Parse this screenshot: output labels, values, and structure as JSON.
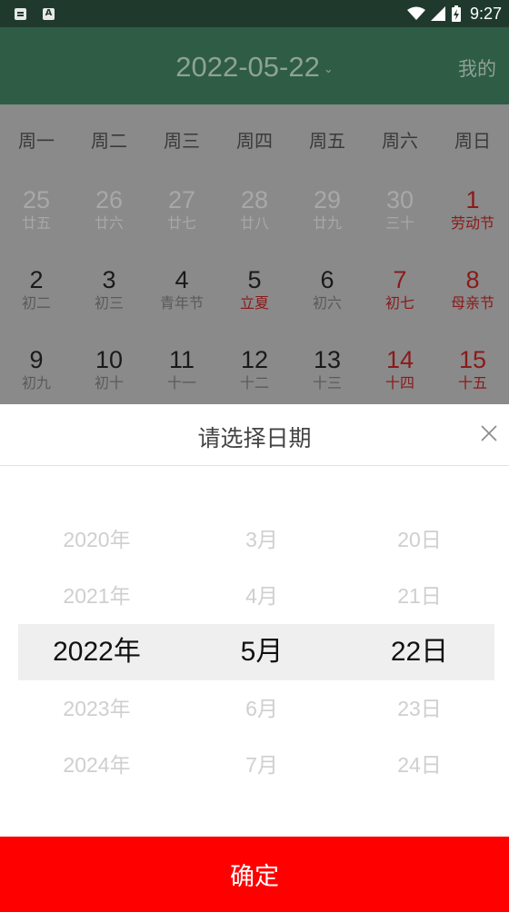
{
  "status_bar": {
    "time": "9:27",
    "icons": [
      "message-icon",
      "a-app-icon",
      "wifi-icon",
      "signal-icon",
      "battery-icon"
    ]
  },
  "header": {
    "date": "2022-05-22",
    "caret": "⌄",
    "mine": "我的"
  },
  "calendar": {
    "weekdays": [
      "周一",
      "周二",
      "周三",
      "周四",
      "周五",
      "周六",
      "周日"
    ],
    "days": [
      {
        "num": "25",
        "lunar": "廿五",
        "state": "muted"
      },
      {
        "num": "26",
        "lunar": "廿六",
        "state": "muted"
      },
      {
        "num": "27",
        "lunar": "廿七",
        "state": "muted"
      },
      {
        "num": "28",
        "lunar": "廿八",
        "state": "muted"
      },
      {
        "num": "29",
        "lunar": "廿九",
        "state": "muted"
      },
      {
        "num": "30",
        "lunar": "三十",
        "state": "muted"
      },
      {
        "num": "1",
        "lunar": "劳动节",
        "state": "weekend festival"
      },
      {
        "num": "2",
        "lunar": "初二",
        "state": ""
      },
      {
        "num": "3",
        "lunar": "初三",
        "state": ""
      },
      {
        "num": "4",
        "lunar": "青年节",
        "state": ""
      },
      {
        "num": "5",
        "lunar": "立夏",
        "state": "festival"
      },
      {
        "num": "6",
        "lunar": "初六",
        "state": ""
      },
      {
        "num": "7",
        "lunar": "初七",
        "state": "weekend festival"
      },
      {
        "num": "8",
        "lunar": "母亲节",
        "state": "weekend festival"
      },
      {
        "num": "9",
        "lunar": "初九",
        "state": ""
      },
      {
        "num": "10",
        "lunar": "初十",
        "state": ""
      },
      {
        "num": "11",
        "lunar": "十一",
        "state": ""
      },
      {
        "num": "12",
        "lunar": "十二",
        "state": ""
      },
      {
        "num": "13",
        "lunar": "十三",
        "state": ""
      },
      {
        "num": "14",
        "lunar": "十四",
        "state": "weekend festival"
      },
      {
        "num": "15",
        "lunar": "十五",
        "state": "weekend festival"
      }
    ]
  },
  "dialog": {
    "title": "请选择日期",
    "confirm": "确定",
    "years": [
      "2020年",
      "2021年",
      "2022年",
      "2023年",
      "2024年"
    ],
    "months": [
      "3月",
      "4月",
      "5月",
      "6月",
      "7月"
    ],
    "days": [
      "20日",
      "21日",
      "22日",
      "23日",
      "24日"
    ],
    "selected_index": 2
  },
  "colors": {
    "status_bar": "#1f3a2d",
    "header": "#2e5c45",
    "overlay_calendar": "#8a8a8a",
    "holiday_red": "#8b1a1a",
    "confirm_red": "#fe0000"
  }
}
